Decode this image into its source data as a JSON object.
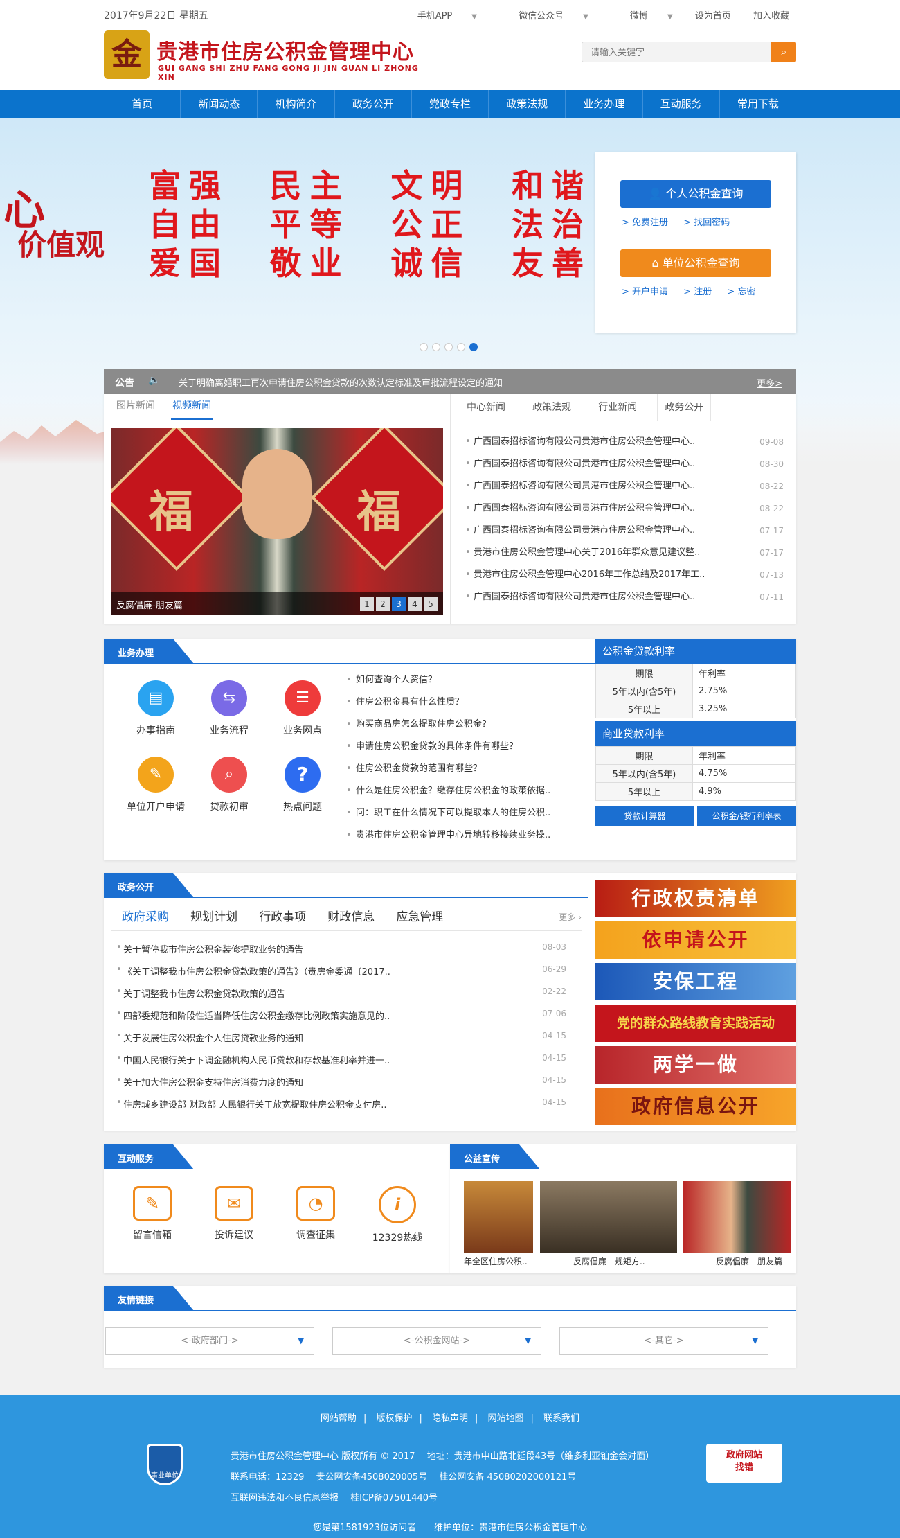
{
  "topbar": {
    "date": "2017年9月22日 星期五",
    "links": [
      "手机APP",
      "微信公众号",
      "微博",
      "设为首页",
      "加入收藏"
    ]
  },
  "header": {
    "title": "贵港市住房公积金管理中心",
    "subtitle": "GUI GANG SHI ZHU FANG GONG JI JIN GUAN LI ZHONG XIN",
    "search_placeholder": "请输入关键字"
  },
  "nav": [
    "首页",
    "新闻动态",
    "机构简介",
    "政务公开",
    "党政专栏",
    "政策法规",
    "业务办理",
    "互动服务",
    "常用下载"
  ],
  "banner": {
    "heart": "心",
    "values_word": "价值观",
    "rows": [
      [
        "富强",
        "民主",
        "文明",
        "和谐"
      ],
      [
        "自由",
        "平等",
        "公正",
        "法治"
      ],
      [
        "爱国",
        "敬业",
        "诚信",
        "友善"
      ]
    ],
    "slide_count": 5,
    "active_slide": 5
  },
  "login": {
    "personal_btn": "个人公积金查询",
    "personal_links": [
      "> 免费注册",
      "> 找回密码"
    ],
    "unit_btn": "单位公积金查询",
    "unit_links": [
      "> 开户申请",
      "> 注册",
      "> 忘密"
    ]
  },
  "notice": {
    "label": "公告",
    "text": "关于明确离婚职工再次申请住房公积金贷款的次数认定标准及审批流程设定的通知",
    "more": "更多>"
  },
  "news": {
    "left_tabs": [
      "图片新闻",
      "视频新闻"
    ],
    "photo_caption": "反腐倡廉-朋友篇",
    "pages": [
      "1",
      "2",
      "3",
      "4",
      "5"
    ],
    "active_page": "3",
    "right_tabs": [
      "中心新闻",
      "政策法规",
      "行业新闻",
      "政务公开"
    ],
    "items": [
      {
        "t": "广西国泰招标咨询有限公司贵港市住房公积金管理中心..",
        "d": "09-08"
      },
      {
        "t": "广西国泰招标咨询有限公司贵港市住房公积金管理中心..",
        "d": "08-30"
      },
      {
        "t": "广西国泰招标咨询有限公司贵港市住房公积金管理中心..",
        "d": "08-22"
      },
      {
        "t": "广西国泰招标咨询有限公司贵港市住房公积金管理中心..",
        "d": "08-22"
      },
      {
        "t": "广西国泰招标咨询有限公司贵港市住房公积金管理中心..",
        "d": "07-17"
      },
      {
        "t": "贵港市住房公积金管理中心关于2016年群众意见建议整..",
        "d": "07-17"
      },
      {
        "t": "贵港市住房公积金管理中心2016年工作总结及2017年工..",
        "d": "07-13"
      },
      {
        "t": "广西国泰招标咨询有限公司贵港市住房公积金管理中心..",
        "d": "07-11"
      }
    ]
  },
  "biz": {
    "title": "业务办理",
    "icons": [
      "办事指南",
      "业务流程",
      "业务网点",
      "单位开户申请",
      "贷款初审",
      "热点问题"
    ],
    "questions": [
      "如何查询个人资信？",
      "住房公积金具有什么性质？",
      "购买商品房怎么提取住房公积金？",
      "申请住房公积金贷款的具体条件有哪些？",
      "住房公积金贷款的范围有哪些？",
      "什么是住房公积金？缴存住房公积金的政策依据..",
      "问：职工在什么情况下可以提取本人的住房公积..",
      "贵港市住房公积金管理中心异地转移接续业务操.."
    ],
    "rates": {
      "gjj_title": "公积金贷款利率",
      "biz_title": "商业贷款利率",
      "col_term": "期限",
      "col_rate": "年利率",
      "gjj_rows": [
        [
          "5年以内(含5年)",
          "2.75%"
        ],
        [
          "5年以上",
          "3.25%"
        ]
      ],
      "biz_rows": [
        [
          "5年以内(含5年)",
          "4.75%"
        ],
        [
          "5年以上",
          "4.9%"
        ]
      ],
      "btn_calc": "贷款计算器",
      "btn_bank": "公积金/银行利率表"
    }
  },
  "gov": {
    "title": "政务公开",
    "tabs": [
      "政府采购",
      "规划计划",
      "行政事项",
      "财政信息",
      "应急管理"
    ],
    "more": "更多 ›",
    "items": [
      {
        "t": "关于暂停我市住房公积金装修提取业务的通告",
        "d": "08-03"
      },
      {
        "t": "《关于调整我市住房公积金贷款政策的通告》（贵房金委通〔2017..",
        "d": "06-29"
      },
      {
        "t": "关于调整我市住房公积金贷款政策的通告",
        "d": "02-22"
      },
      {
        "t": "四部委规范和阶段性适当降低住房公积金缴存比例政策实施意见的..",
        "d": "07-06"
      },
      {
        "t": "关于发展住房公积金个人住房贷款业务的通知",
        "d": "04-15"
      },
      {
        "t": "中国人民银行关于下调金融机构人民币贷款和存款基准利率并进一..",
        "d": "04-15"
      },
      {
        "t": "关于加大住房公积金支持住房消费力度的通知",
        "d": "04-15"
      },
      {
        "t": "住房城乡建设部 财政部 人民银行关于放宽提取住房公积金支付房..",
        "d": "04-15"
      }
    ],
    "banners": [
      "行政权责清单",
      "依申请公开",
      "安保工程",
      "党的群众路线教育实践活动",
      "两学一做",
      "政府信息公开"
    ]
  },
  "hudong": {
    "title": "互动服务",
    "items": [
      "留言信箱",
      "投诉建议",
      "调查征集",
      "12329热线"
    ]
  },
  "gongyi": {
    "title": "公益宣传",
    "captions": [
      "年全区住房公积..",
      "反腐倡廉 - 规矩方..",
      "反腐倡廉 - 朋友篇"
    ]
  },
  "friends": {
    "title": "友情链接",
    "selects": [
      "<-政府部门->",
      "<-公积金网站->",
      "<-其它->"
    ]
  },
  "footer": {
    "links": [
      "网站帮助",
      "版权保护",
      "隐私声明",
      "网站地图",
      "联系我们"
    ],
    "badge": "事业单位",
    "line1": "贵港市住房公积金管理中心 版权所有 © 2017　 地址：贵港市中山路北延段43号（维多利亚铂金会对面）",
    "line2": "联系电话：12329　 贵公网安备4508020005号　 桂公网安备 45080202000121号",
    "line3": "互联网违法和不良信息举报　 桂ICP备07501440号",
    "gov_site_1": "政府网站",
    "gov_site_2": "找错",
    "bottom": "您是第1581923位访问者　　维护单位：贵港市住房公积金管理中心"
  },
  "colors": {
    "primary": "#1b6fd1",
    "accent": "#f08a1c",
    "red": "#c4151c",
    "footer": "#2e96de"
  }
}
